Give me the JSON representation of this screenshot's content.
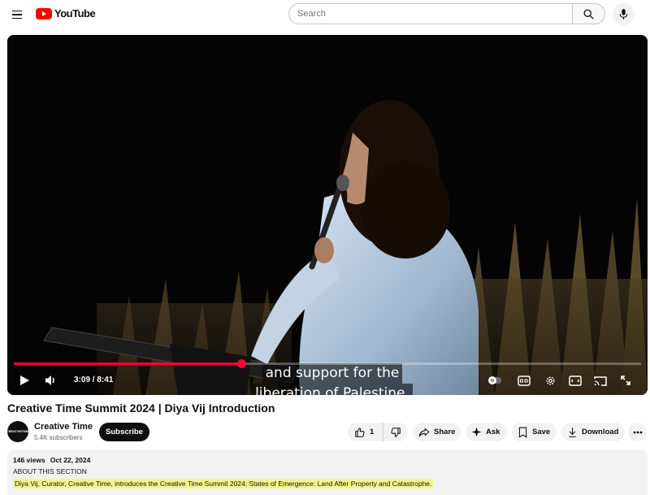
{
  "header": {
    "logo_text": "YouTube",
    "search_placeholder": "Search"
  },
  "player": {
    "caption_line1": "and support for the",
    "caption_line2": "liberation of Palestine,",
    "current_time": "3:09",
    "duration": "8:41",
    "time_display": "3:09 / 8:41",
    "progress": 0.363,
    "colors": {
      "progress": "#ff0033"
    }
  },
  "video": {
    "title": "Creative Time Summit 2024 | Diya Vij Introduction"
  },
  "channel": {
    "avatar_text": "CREATIVETIME",
    "name": "Creative Time",
    "subscribers": "5.4K subscribers",
    "subscribe_label": "Subscribe"
  },
  "actions": {
    "like_count": "1",
    "share_label": "Share",
    "ask_label": "Ask",
    "save_label": "Save",
    "download_label": "Download"
  },
  "description": {
    "views": "146 views",
    "date": "Oct 22, 2024",
    "section_label": "ABOUT THIS SECTION",
    "text": "Diya Vij, Curator, Creative Time, introduces the Creative Time Summit 2024: States of Emergence: Land After Property and Catastrophe."
  }
}
